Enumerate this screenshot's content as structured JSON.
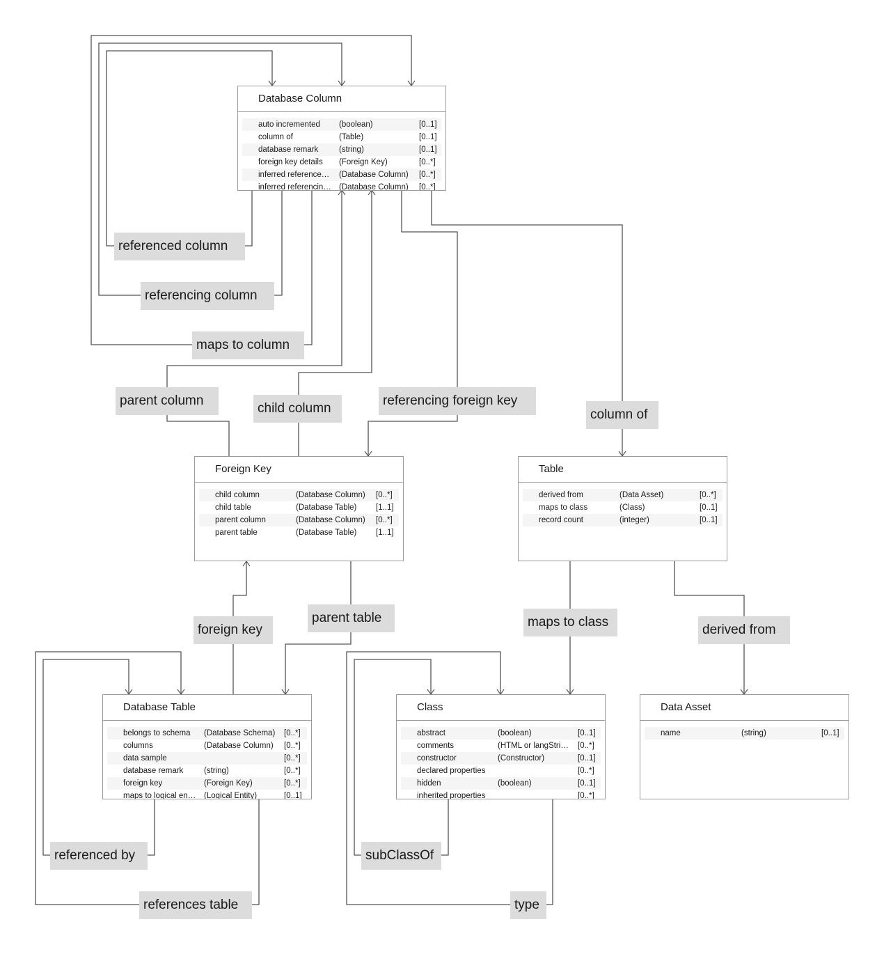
{
  "nodes": {
    "database_column": {
      "title": "Database Column",
      "rows": [
        {
          "name": "auto incremented",
          "type": "(boolean)",
          "card": "[0..1]"
        },
        {
          "name": "column of",
          "type": "(Table)",
          "card": "[0..1]"
        },
        {
          "name": "database remark",
          "type": "(string)",
          "card": "[0..1]"
        },
        {
          "name": "foreign key details",
          "type": "(Foreign Key)",
          "card": "[0..*]"
        },
        {
          "name": "inferred reference…",
          "type": "(Database Column)",
          "card": "[0..*]"
        },
        {
          "name": "inferred referencin…",
          "type": "(Database Column)",
          "card": "[0..*]"
        }
      ]
    },
    "foreign_key": {
      "title": "Foreign Key",
      "rows": [
        {
          "name": "child column",
          "type": "(Database Column)",
          "card": "[0..*]"
        },
        {
          "name": "child table",
          "type": "(Database Table)",
          "card": "[1..1]"
        },
        {
          "name": "parent column",
          "type": "(Database Column)",
          "card": "[0..*]"
        },
        {
          "name": "parent table",
          "type": "(Database Table)",
          "card": "[1..1]"
        }
      ]
    },
    "table": {
      "title": "Table",
      "rows": [
        {
          "name": "derived from",
          "type": "(Data Asset)",
          "card": "[0..*]"
        },
        {
          "name": "maps to class",
          "type": "(Class)",
          "card": "[0..1]"
        },
        {
          "name": "record count",
          "type": "(integer)",
          "card": "[0..1]"
        }
      ]
    },
    "database_table": {
      "title": "Database Table",
      "rows": [
        {
          "name": "belongs to schema",
          "type": "(Database Schema)",
          "card": "[0..*]"
        },
        {
          "name": "columns",
          "type": "(Database Column)",
          "card": "[0..*]"
        },
        {
          "name": "data sample",
          "type": "",
          "card": "[0..*]"
        },
        {
          "name": "database remark",
          "type": "(string)",
          "card": "[0..*]"
        },
        {
          "name": "foreign key",
          "type": "(Foreign Key)",
          "card": "[0..*]"
        },
        {
          "name": "maps to logical en…",
          "type": "(Logical Entity)",
          "card": "[0..1]"
        }
      ]
    },
    "class": {
      "title": "Class",
      "rows": [
        {
          "name": "abstract",
          "type": "(boolean)",
          "card": "[0..1]"
        },
        {
          "name": "comments",
          "type": "(HTML or langStri…",
          "card": "[0..*]"
        },
        {
          "name": "constructor",
          "type": "(Constructor)",
          "card": "[0..1]"
        },
        {
          "name": "declared properties",
          "type": "",
          "card": "[0..*]"
        },
        {
          "name": "hidden",
          "type": "(boolean)",
          "card": "[0..1]"
        },
        {
          "name": "inherited properties",
          "type": "",
          "card": "[0..*]"
        }
      ]
    },
    "data_asset": {
      "title": "Data Asset",
      "rows": [
        {
          "name": "name",
          "type": "(string)",
          "card": "[0..1]"
        }
      ]
    }
  },
  "edge_labels": {
    "referenced_column": "referenced column",
    "referencing_column": "referencing column",
    "maps_to_column": "maps to column",
    "parent_column": "parent column",
    "child_column": "child column",
    "referencing_foreign_key": "referencing foreign key",
    "column_of": "column of",
    "foreign_key": "foreign key",
    "parent_table": "parent table",
    "maps_to_class": "maps to class",
    "derived_from": "derived from",
    "referenced_by": "referenced by",
    "references_table": "references table",
    "subClassOf": "subClassOf",
    "type": "type"
  },
  "colors": {
    "edge": "#555555",
    "node_border": "#9a9a9a",
    "label_bg": "#dcdcdc",
    "row_stripe": "#f5f5f5"
  }
}
